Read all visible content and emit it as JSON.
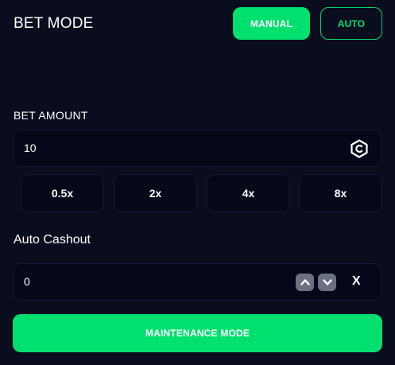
{
  "header": {
    "title": "BET MODE",
    "manual_label": "MANUAL",
    "auto_label": "AUTO",
    "active_mode": "MANUAL"
  },
  "bet_amount": {
    "label": "BET AMOUNT",
    "value": "10",
    "currency_icon": "coin-c-icon"
  },
  "multipliers": [
    "0.5x",
    "2x",
    "4x",
    "8x"
  ],
  "auto_cashout": {
    "label": "Auto Cashout",
    "value": "0",
    "clear_label": "X",
    "up_icon": "chevron-up-icon",
    "down_icon": "chevron-down-icon"
  },
  "action": {
    "label": "MAINTENANCE MODE"
  },
  "colors": {
    "background": "#090d1e",
    "accent": "#00e06f",
    "input_bg": "#050818",
    "input_border": "#141b38",
    "stepper_bg": "#6b7180"
  }
}
